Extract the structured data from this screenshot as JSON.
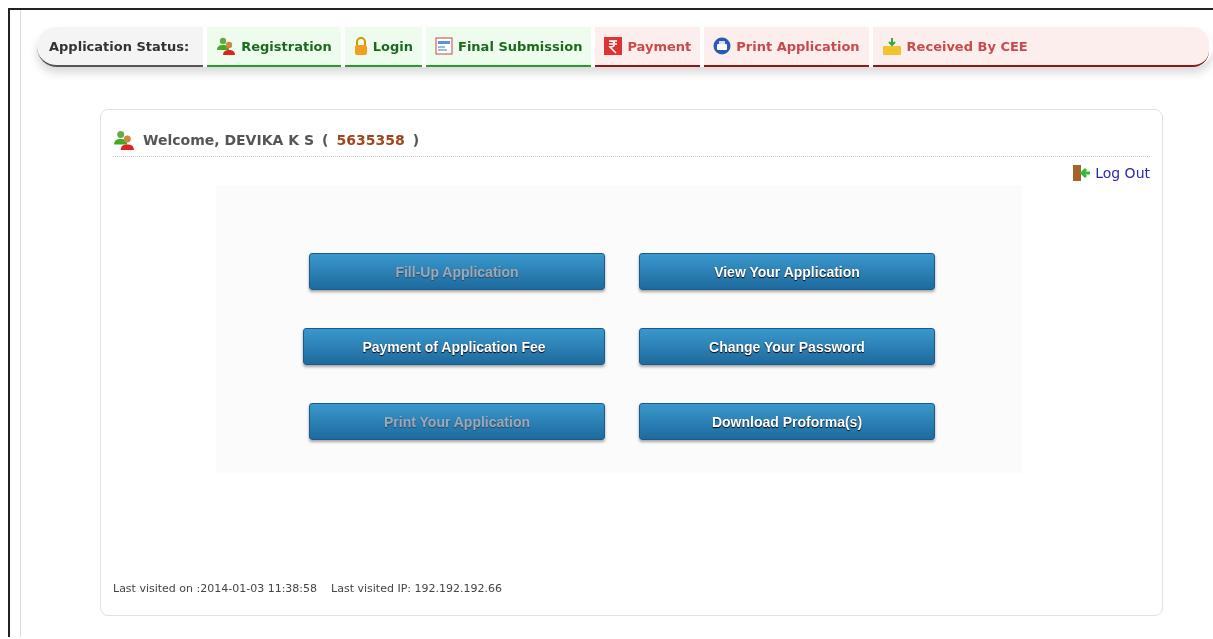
{
  "status_bar": {
    "label": "Application Status:",
    "steps": [
      {
        "label": "Registration",
        "kind": "users",
        "completed": true
      },
      {
        "label": "Login",
        "kind": "lock",
        "completed": true
      },
      {
        "label": "Final Submission",
        "kind": "form",
        "completed": true
      },
      {
        "label": "Payment",
        "kind": "rupee",
        "completed": false
      },
      {
        "label": "Print Application",
        "kind": "printer",
        "completed": false
      },
      {
        "label": "Received By CEE",
        "kind": "inbox",
        "completed": false
      }
    ]
  },
  "welcome": {
    "greeting": "Welcome, DEVIKA K S",
    "open": "(",
    "id": "5635358",
    "close": ")"
  },
  "logout": "Log Out",
  "buttons": [
    {
      "label": "Fill-Up Application",
      "disabled": true,
      "wide": false
    },
    {
      "label": "View Your Application",
      "disabled": false,
      "wide": false
    },
    {
      "label": "Payment of Application Fee",
      "disabled": false,
      "wide": true
    },
    {
      "label": "Change Your Password",
      "disabled": false,
      "wide": false
    },
    {
      "label": "Print Your Application",
      "disabled": true,
      "wide": false
    },
    {
      "label": "Download Proforma(s)",
      "disabled": false,
      "wide": false
    }
  ],
  "footer": {
    "last_visited": "Last visited on :2014-01-03 11:38:58",
    "last_ip": "Last visited IP: 192.192.192.66"
  }
}
